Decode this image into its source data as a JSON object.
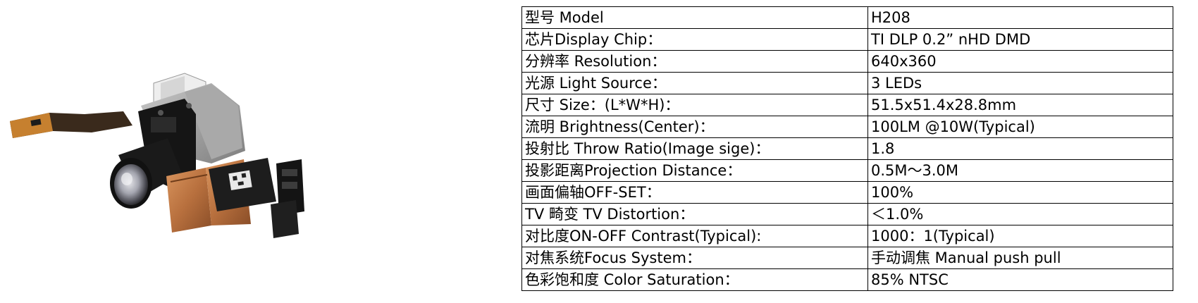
{
  "image": {
    "alt": "DLP optical engine module with lens, ribbon cable and copper heat sink",
    "icon": "projector-engine-photo"
  },
  "spec_table": {
    "rows": [
      {
        "label": "型号 Model",
        "value": "H208"
      },
      {
        "label": "芯片Display Chip：",
        "value": "TI DLP 0.2” nHD DMD"
      },
      {
        "label": "分辨率  Resolution：",
        "value": "640x360"
      },
      {
        "label": "光源 Light Source：",
        "value": "3 LEDs"
      },
      {
        "label": "尺寸 Size：(L*W*H)：",
        "value": "51.5x51.4x28.8mm"
      },
      {
        "label": "流明 Brightness(Center)：",
        "value": "100LM @10W(Typical)"
      },
      {
        "label": "投射比 Throw Ratio(Image sige)：",
        "value": "1.8"
      },
      {
        "label": "投影距离Projection Distance：",
        "value": "0.5M～3.0M"
      },
      {
        "label": "画面偏轴OFF-SET：",
        "value": "100%"
      },
      {
        "label": "TV 畸变 TV Distortion：",
        "value": "＜1.0%"
      },
      {
        "label": "对比度ON-OFF Contrast(Typical):",
        "value": "1000：1(Typical)"
      },
      {
        "label": "对焦系统Focus System：",
        "value": "手动调焦 Manual push pull"
      },
      {
        "label": "色彩饱和度 Color Saturation：",
        "value": "85% NTSC"
      }
    ]
  }
}
